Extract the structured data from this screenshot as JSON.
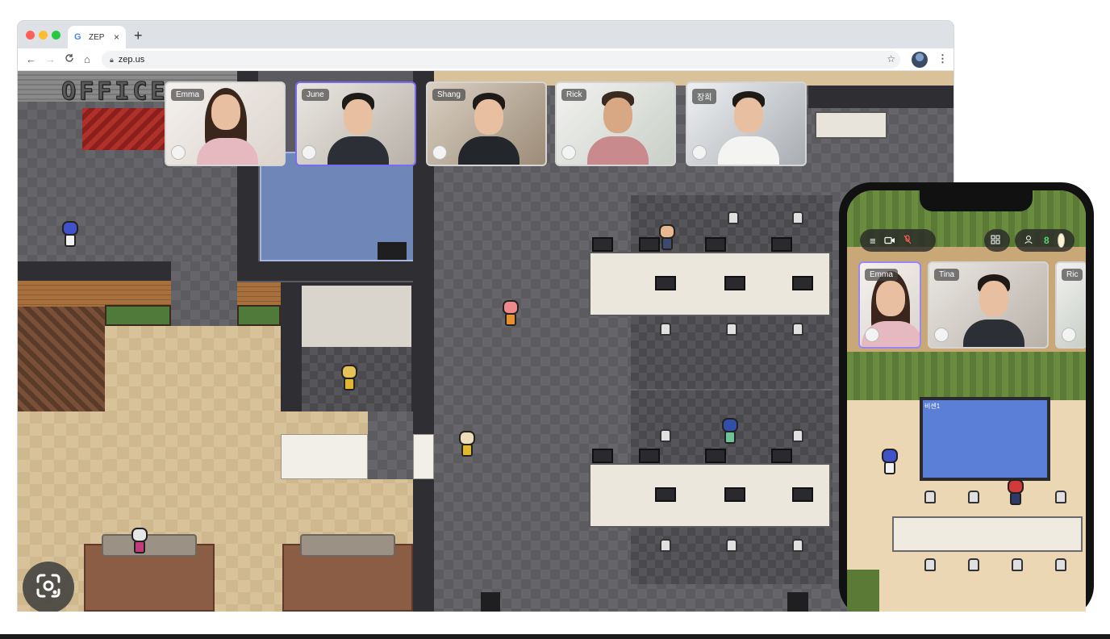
{
  "browser": {
    "tab_title": "ZEP",
    "tab_favicon": "G",
    "tab_close_icon": "×",
    "new_tab_icon": "+",
    "url": "zep.us",
    "nav": {
      "back": "←",
      "forward": "→",
      "reload": "C",
      "home": "⌂"
    },
    "star_icon": "☆",
    "menu_icon": "⋮"
  },
  "map": {
    "office_sign": "OFFICE"
  },
  "video_tiles": [
    {
      "name": "Emma",
      "active": false
    },
    {
      "name": "June",
      "active": true
    },
    {
      "name": "Shang",
      "active": false
    },
    {
      "name": "Rick",
      "active": false
    },
    {
      "name": "장희",
      "active": false
    }
  ],
  "phone": {
    "menu_icon": "≡",
    "camera_icon": "camera-icon",
    "mic_icon": "mic-muted-icon",
    "grid_icon": "grid-icon",
    "user_count": "8",
    "tiles": [
      {
        "name": "Emma",
        "active": true
      },
      {
        "name": "Tina",
        "active": false
      },
      {
        "name": "Ric",
        "active": false
      }
    ],
    "screen_label": "비센1"
  },
  "colors": {
    "active_border": "#7a6cf0",
    "mute_red": "#ff5a5a",
    "count_green": "#58d36e"
  }
}
